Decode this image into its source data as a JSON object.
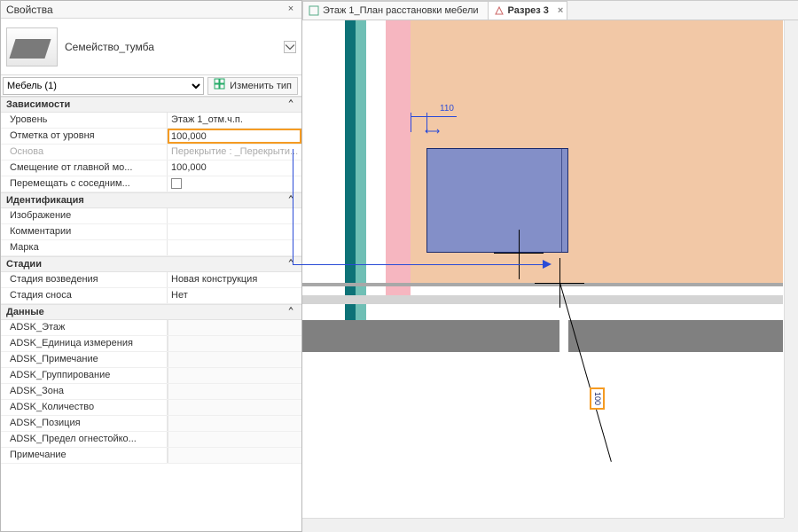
{
  "panel": {
    "title": "Свойства"
  },
  "family": {
    "name": "Семейство_тумба"
  },
  "selector": {
    "value": "Мебель (1)",
    "edit_type_label": "Изменить тип"
  },
  "groups": {
    "deps": {
      "title": "Зависимости",
      "rows": {
        "level": {
          "name": "Уровень",
          "value": "Этаж 1_отм.ч.п."
        },
        "offset": {
          "name": "Отметка от уровня",
          "value": "100,000"
        },
        "base": {
          "name": "Основа",
          "value": "Перекрытие : _Перекрыти..."
        },
        "host_offset": {
          "name": "Смещение от главной мо...",
          "value": "100,000"
        },
        "move_with": {
          "name": "Перемещать с соседним...",
          "checked": false
        }
      }
    },
    "ident": {
      "title": "Идентификация",
      "rows": {
        "image": {
          "name": "Изображение",
          "value": ""
        },
        "comments": {
          "name": "Комментарии",
          "value": ""
        },
        "mark": {
          "name": "Марка",
          "value": ""
        }
      }
    },
    "phases": {
      "title": "Стадии",
      "rows": {
        "created": {
          "name": "Стадия возведения",
          "value": "Новая конструкция"
        },
        "demolished": {
          "name": "Стадия сноса",
          "value": "Нет"
        }
      }
    },
    "data": {
      "title": "Данные",
      "rows": {
        "adsk_floor": {
          "name": "ADSK_Этаж",
          "value": ""
        },
        "adsk_unit": {
          "name": "ADSK_Единица измерения",
          "value": ""
        },
        "adsk_note": {
          "name": "ADSK_Примечание",
          "value": ""
        },
        "adsk_group": {
          "name": "ADSK_Группирование",
          "value": ""
        },
        "adsk_zone": {
          "name": "ADSK_Зона",
          "value": ""
        },
        "adsk_qty": {
          "name": "ADSK_Количество",
          "value": ""
        },
        "adsk_pos": {
          "name": "ADSK_Позиция",
          "value": ""
        },
        "adsk_fire": {
          "name": "ADSK_Предел огнестойко...",
          "value": ""
        },
        "note": {
          "name": "Примечание",
          "value": ""
        }
      }
    }
  },
  "tabs": {
    "t1": "Этаж 1_План расстановки мебели",
    "t2": "Разрез 3"
  },
  "canvas": {
    "dim_110": "110",
    "tag_value": "100"
  }
}
